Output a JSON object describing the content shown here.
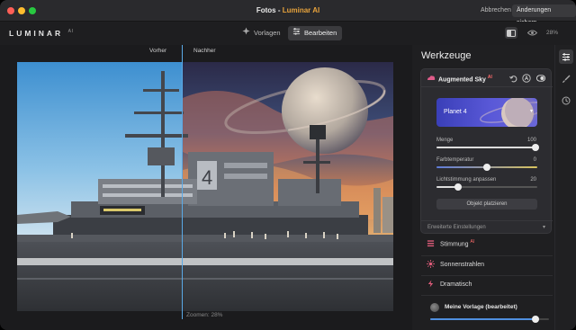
{
  "titlebar": {
    "title_doc": "Fotos",
    "title_sep": " - ",
    "title_app": "Luminar AI",
    "cancel_label": "Abbrechen",
    "save_label": "Änderungen sichern"
  },
  "toolbar": {
    "logo": "LUMINAR",
    "logo_suffix": "AI",
    "tabs": [
      {
        "label": "Vorlagen",
        "icon": "templates-icon",
        "active": false
      },
      {
        "label": "Bearbeiten",
        "icon": "edit-icon",
        "active": true
      }
    ],
    "zoom": "28%"
  },
  "canvas": {
    "before_label": "Vorher",
    "after_label": "Nachher",
    "zoom_status": "Zoomen: 28%"
  },
  "panel": {
    "title": "Werkzeuge",
    "active_tool": {
      "name": "Augmented Sky",
      "badge": "AI",
      "sky_preset": "Planet 4",
      "sliders": [
        {
          "label": "Menge",
          "value": "100",
          "level": 100
        },
        {
          "label": "Farbtemperatur",
          "value": "0",
          "level": 50
        },
        {
          "label": "Lichtstimmung anpassen",
          "value": "20",
          "level": 20
        }
      ],
      "place_object_button": "Objekt platzieren",
      "advanced": "Erweiterte Einstellungen"
    },
    "tools": [
      {
        "label": "Stimmung",
        "badge": "AI",
        "icon": "mood-icon"
      },
      {
        "label": "Sonnenstrahlen",
        "badge": "",
        "icon": "sunrays-icon"
      },
      {
        "label": "Dramatisch",
        "badge": "",
        "icon": "dramatic-icon"
      }
    ],
    "preset": {
      "name": "Meine Vorlage (bearbeitet)",
      "level": 90
    }
  },
  "colors": {
    "accent": "#e8a33c",
    "split_line": "#5aa9e6",
    "sky_select": "#4b4ad0",
    "preset_slider": "#4f8fe0"
  }
}
